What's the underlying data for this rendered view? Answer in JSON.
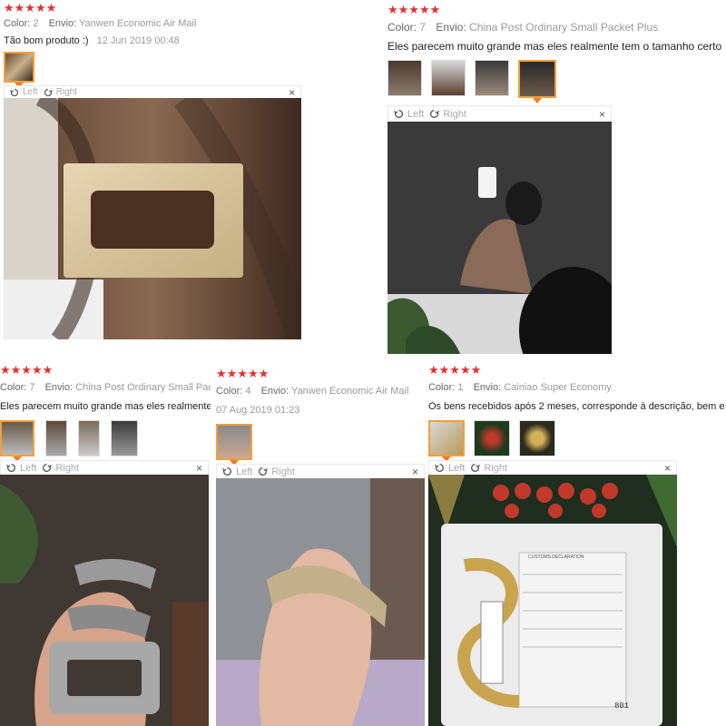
{
  "reviews": [
    {
      "stars": "★★★★★",
      "color_label": "Color:",
      "color_value": "2",
      "shipping_label": "Envio:",
      "shipping_value": "Yanwen Economic Air Mail",
      "text": "Tão bom produto :)",
      "date": "12 Jun 2019 00:48"
    },
    {
      "stars": "★★★★★",
      "color_label": "Color:",
      "color_value": "7",
      "shipping_label": "Envio:",
      "shipping_value": "China Post Ordinary Small Packet Plus",
      "text": "Eles parecem muito grande mas eles realmente tem o tamanho certo"
    },
    {
      "stars": "★★★★★",
      "color_label": "Color:",
      "color_value": "7",
      "shipping_label": "Envio:",
      "shipping_value": "China Post Ordinary Small Pac",
      "text": "Eles parecem muito grande mas eles realmente"
    },
    {
      "stars": "★★★★★",
      "color_label": "Color:",
      "color_value": "4",
      "shipping_label": "Envio:",
      "shipping_value": "Yanwen Economic Air Mail",
      "date": "07 Aug 2019 01:23"
    },
    {
      "stars": "★★★★★",
      "color_label": "Color:",
      "color_value": "1",
      "shipping_label": "Envio:",
      "shipping_value": "Cainiao Super Economy",
      "text": "Os bens recebidos após 2 meses, corresponde à descrição, bem e"
    }
  ],
  "viewer": {
    "left_label": "Left",
    "right_label": "Right",
    "close_label": "×"
  },
  "package_label": {
    "customs": "CUSTOMS DECLARATION",
    "number": "801"
  },
  "colors": {
    "star": "#e62e2e",
    "selected_border": "#f0a03c"
  },
  "icons": [
    "rotate-left-icon",
    "rotate-right-icon",
    "close-icon"
  ]
}
